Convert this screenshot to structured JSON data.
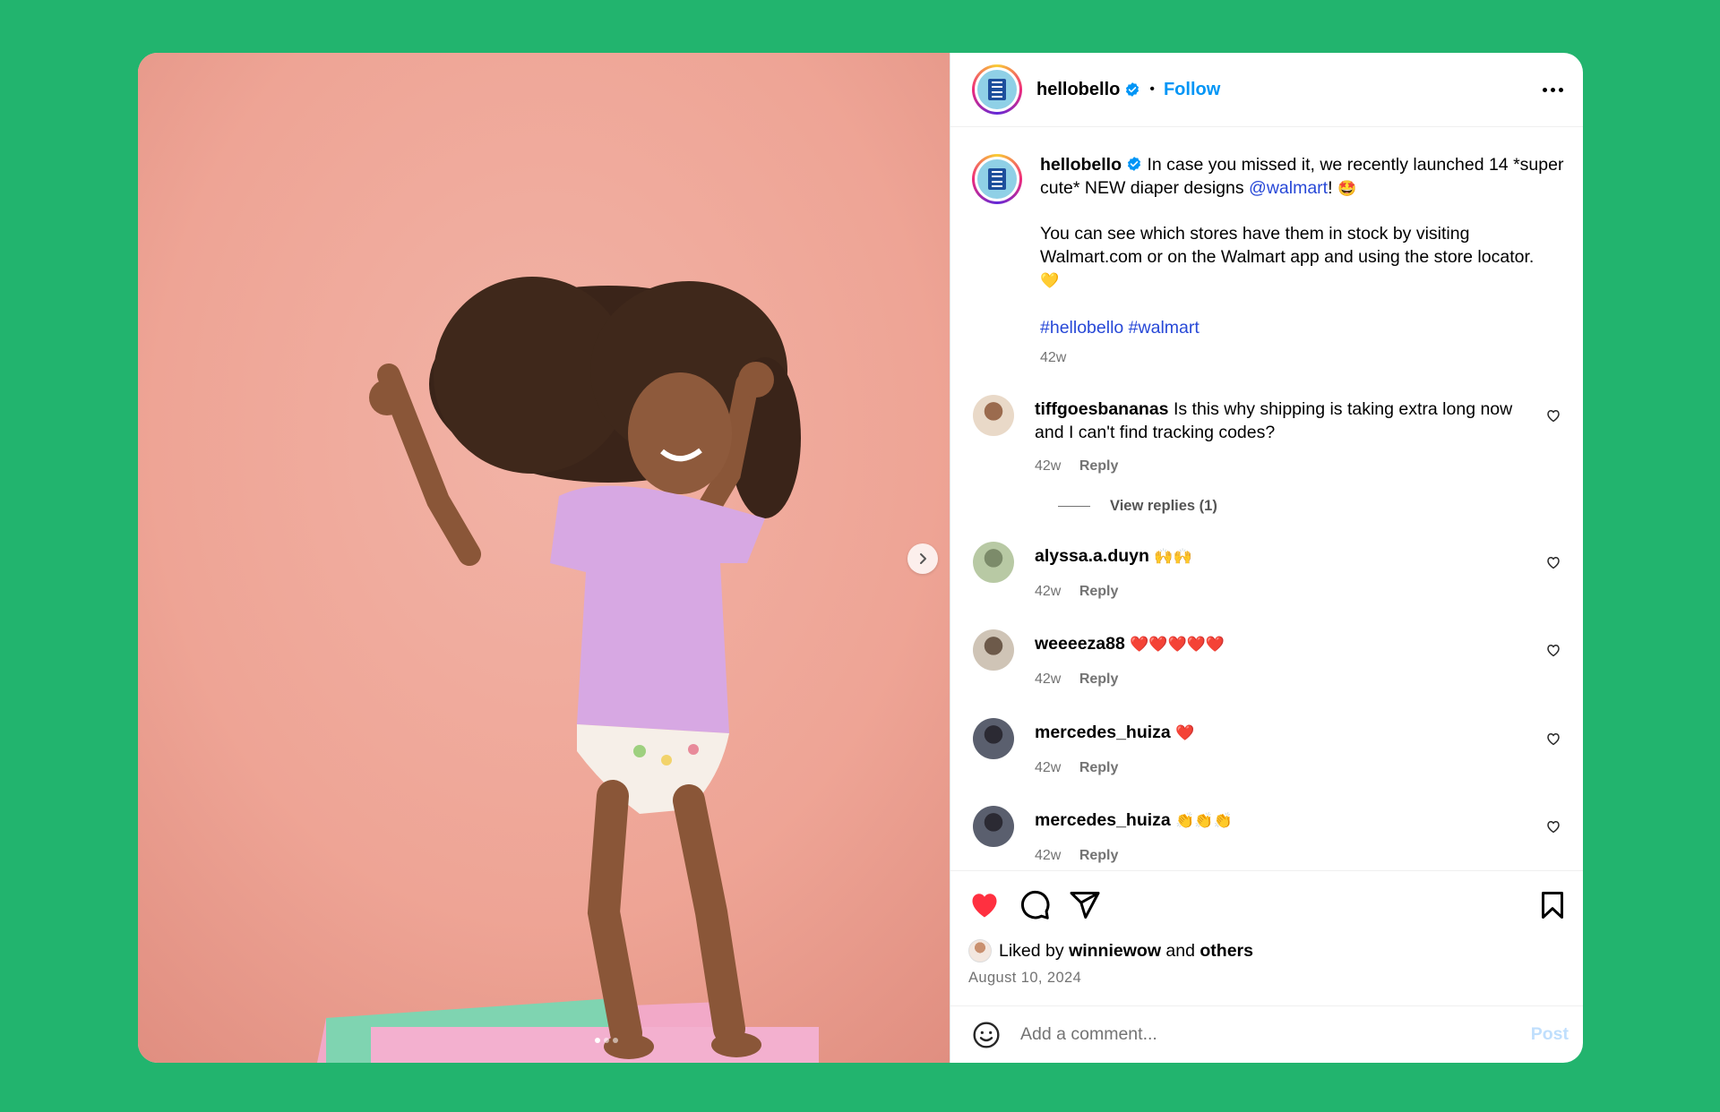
{
  "post": {
    "username": "hellobello",
    "follow_label": "Follow",
    "separator": "•",
    "more_icon": "more-horizontal-icon",
    "verified_icon": "verified-badge-icon",
    "carousel": {
      "slides": 3,
      "active_slide": 1
    },
    "next_icon": "chevron-right-icon"
  },
  "caption": {
    "username": "hellobello",
    "text_part1": "In case you missed it, we recently launched 14 *super cute* NEW diaper designs ",
    "mention": "@walmart",
    "text_part2": "! ",
    "emoji1": "🤩",
    "text_part3": "You can see which stores have them in stock by visiting Walmart.com or on the Walmart app and using the store locator.",
    "emoji2": "💛",
    "hashtag1": "#hellobello",
    "hashtag2": "#walmart",
    "time": "42w"
  },
  "comments": [
    {
      "username": "tiffgoesbananas",
      "text": "Is this why shipping is taking extra long now and I can't find tracking codes?",
      "time": "42w",
      "reply_label": "Reply",
      "avatar_colors": [
        "#e9d9c8",
        "#9b6b4e"
      ]
    },
    {
      "username": "alyssa.a.duyn",
      "text": "🙌🙌",
      "time": "42w",
      "reply_label": "Reply",
      "avatar_colors": [
        "#b8c9a4",
        "#7c8b6a"
      ]
    },
    {
      "username": "weeeeza88",
      "text": "❤️❤️❤️❤️❤️",
      "time": "42w",
      "reply_label": "Reply",
      "avatar_colors": [
        "#cfc4b6",
        "#6d5a4a"
      ]
    },
    {
      "username": "mercedes_huiza",
      "text": "❤️",
      "time": "42w",
      "reply_label": "Reply",
      "avatar_colors": [
        "#5a5f6e",
        "#2b2a33"
      ]
    },
    {
      "username": "mercedes_huiza",
      "text": "👏👏👏",
      "time": "42w",
      "reply_label": "Reply",
      "avatar_colors": [
        "#5a5f6e",
        "#2b2a33"
      ]
    }
  ],
  "view_replies_label": "View replies (1)",
  "actions": {
    "liked": true,
    "like_color": "#ff3040",
    "icons": [
      "heart-icon",
      "comment-icon",
      "share-icon",
      "bookmark-icon"
    ]
  },
  "likes": {
    "prefix": "Liked by",
    "user": "winniewow",
    "and": "and",
    "others": "others"
  },
  "date": "August 10, 2024",
  "add_comment": {
    "placeholder": "Add a comment...",
    "post_label": "Post"
  },
  "colors": {
    "background": "#22b46e",
    "link": "#0095f6",
    "mention": "#2748d7"
  }
}
